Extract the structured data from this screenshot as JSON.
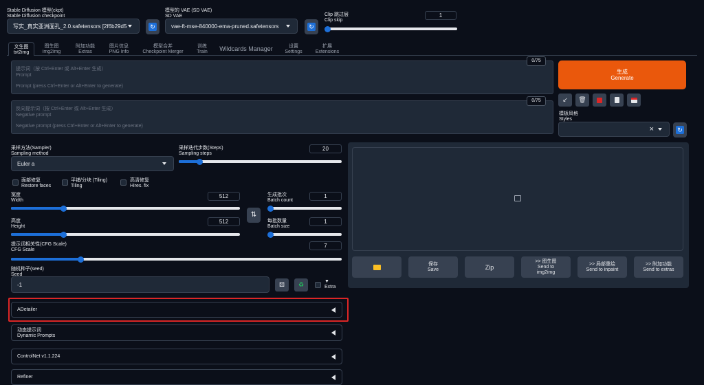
{
  "checkpoint": {
    "label_cn": "Stable Diffusion 模型(ckpt)",
    "label_en": "Stable Diffusion checkpoint",
    "value": "写实_真实亚洲面孔_2.0.safetensors [2f6b29d5"
  },
  "vae": {
    "label_cn": "模型的 VAE (SD VAE)",
    "label_en": "SD VAE",
    "value": "vae-ft-mse-840000-ema-pruned.safetensors"
  },
  "clip_skip": {
    "label_cn": "Clip 跳过层",
    "label_en": "Clip skip",
    "value": "1",
    "level": 0
  },
  "tabs": [
    {
      "cn": "文生图",
      "en": "txt2img"
    },
    {
      "cn": "图生图",
      "en": "img2img"
    },
    {
      "cn": "附加功能",
      "en": "Extras"
    },
    {
      "cn": "图片信息",
      "en": "PNG Info"
    },
    {
      "cn": "模型合并",
      "en": "Checkpoint Merger"
    },
    {
      "cn": "训练",
      "en": "Train"
    },
    {
      "cn": "Wildcards Manager",
      "en": ""
    },
    {
      "cn": "设置",
      "en": "Settings"
    },
    {
      "cn": "扩展",
      "en": "Extensions"
    }
  ],
  "prompt": {
    "placeholder_cn": "提示词（按 Ctrl+Enter 或 Alt+Enter 生成）",
    "placeholder_en": "Prompt",
    "placeholder_hint": "Prompt (press Ctrl+Enter or Alt+Enter to generate)",
    "counter": "0/75"
  },
  "negative_prompt": {
    "placeholder_cn": "反向提示词（按 Ctrl+Enter 或 Alt+Enter 生成）",
    "placeholder_en": "Negative prompt",
    "placeholder_hint": "Negative prompt (press Ctrl+Enter or Alt+Enter to generate)",
    "counter": "0/75"
  },
  "generate": {
    "cn": "生成",
    "en": "Generate",
    "color": "#ea580c"
  },
  "tool_icons": [
    "arrow-diagonal-icon",
    "trash-icon",
    "red-square-icon",
    "clipboard-icon",
    "save-style-icon"
  ],
  "styles": {
    "label_cn": "模板风格",
    "label_en": "Styles",
    "clear": "×"
  },
  "sampler": {
    "label_cn": "采样方法(Sampler)",
    "label_en": "Sampling method",
    "value": "Euler a"
  },
  "steps": {
    "label_cn": "采样迭代步数(Steps)",
    "label_en": "Sampling steps",
    "value": "20",
    "level": 0.13
  },
  "checkboxes": [
    {
      "cn": "面部修复",
      "en": "Restore faces"
    },
    {
      "cn": "平铺/分块 (Tiling)",
      "en": "Tiling"
    },
    {
      "cn": "高清修复",
      "en": "Hires. fix"
    }
  ],
  "width": {
    "label_cn": "宽度",
    "label_en": "Width",
    "value": "512",
    "level": 0.23
  },
  "height": {
    "label_cn": "高度",
    "label_en": "Height",
    "value": "512",
    "level": 0.23
  },
  "swap_icon": "⇅",
  "batch_count": {
    "label_cn": "生成批次",
    "label_en": "Batch count",
    "value": "1",
    "level": 0
  },
  "batch_size": {
    "label_cn": "每批数量",
    "label_en": "Batch size",
    "value": "1",
    "level": 0
  },
  "cfg": {
    "label_cn": "提示词相关性(CFG Scale)",
    "label_en": "CFG Scale",
    "value": "7",
    "level": 0.21
  },
  "seed": {
    "label_cn": "随机种子(seed)",
    "label_en": "Seed",
    "value": "-1",
    "extra": "Extra",
    "extra_arrow": "▼"
  },
  "seed_icons": [
    "dice-icon",
    "recycle-icon"
  ],
  "accordions": [
    {
      "cn": "ADetailer",
      "en": ""
    },
    {
      "cn": "动态提示词",
      "en": "Dynamic Prompts"
    },
    {
      "cn": "ControlNet v1.1.224",
      "en": ""
    },
    {
      "cn": "Refiner",
      "en": ""
    }
  ],
  "highlight_color": "#dc2626",
  "output_buttons": [
    {
      "cn": "",
      "en": "",
      "icon": "folder-icon"
    },
    {
      "cn": "保存",
      "en": "Save"
    },
    {
      "cn": "Zip",
      "en": ""
    },
    {
      "cn": ">> 图生图",
      "en": "Send to img2img"
    },
    {
      "cn": ">> 局部重绘",
      "en": "Send to inpaint"
    },
    {
      "cn": ">> 附加功能",
      "en": "Send to extras"
    }
  ]
}
